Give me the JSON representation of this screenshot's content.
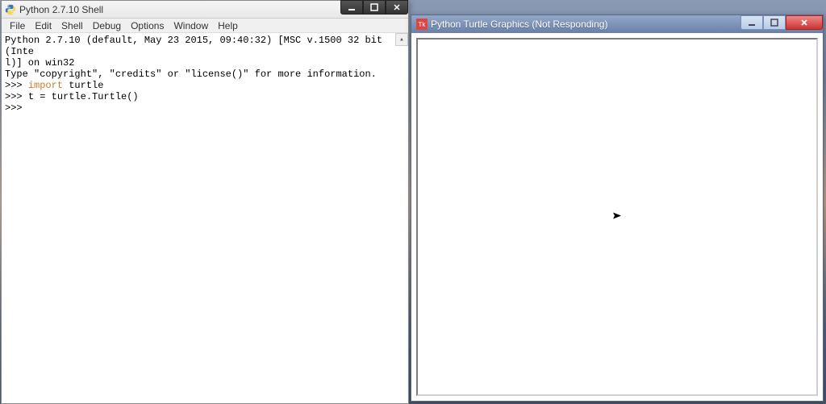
{
  "shell": {
    "title": "Python 2.7.10 Shell",
    "menubar": [
      "File",
      "Edit",
      "Shell",
      "Debug",
      "Options",
      "Window",
      "Help"
    ],
    "lines": {
      "l1": "Python 2.7.10 (default, May 23 2015, 09:40:32) [MSC v.1500 32 bit (Inte",
      "l2": "l)] on win32",
      "l3": "Type \"copyright\", \"credits\" or \"license()\" for more information.",
      "p1": ">>> ",
      "kw_import": "import",
      "p1_rest": " turtle",
      "p2": ">>> ",
      "p2_rest": "t = turtle.Turtle()",
      "p3": ">>> "
    },
    "scroll_up_glyph": "▴"
  },
  "turtle": {
    "title": "Python Turtle Graphics (Not Responding)",
    "icon_label": "Tk"
  }
}
